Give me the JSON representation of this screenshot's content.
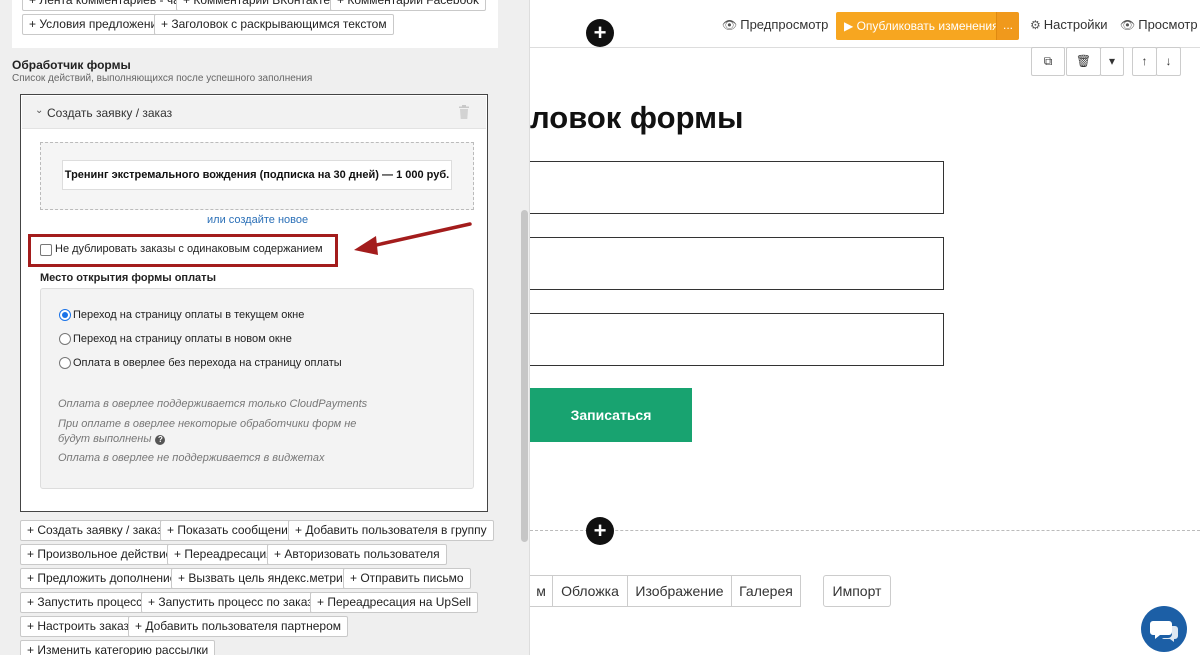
{
  "left_panel": {
    "top_buttons": [
      "+ Лента комментариев - чат",
      "+ Комментарии ВКонтакте",
      "+ Комментарии Facebook",
      "+ Условия предложений",
      "+ Заголовок с раскрывающимся текстом"
    ],
    "section_title": "Обработчик формы",
    "section_subtitle": "Список действий, выполняющихся после успешного заполнения",
    "handler": {
      "title": "Создать заявку / заказ",
      "product": "Тренинг экстремального вождения (подписка на 30 дней) — 1 000 руб.",
      "create_new_link": "или создайте новое",
      "dedupe_label": "Не дублировать заказы с одинаковым содержанием",
      "dedupe_checked": false,
      "payment_title": "Место открытия формы оплаты",
      "payment_options": [
        "Переход на страницу оплаты в текущем окне",
        "Переход на страницу оплаты в новом окне",
        "Оплата в оверлее без перехода на страницу оплаты"
      ],
      "payment_selected": 0,
      "notes": [
        "Оплата в оверлее поддерживается только CloudPayments",
        "При оплате в оверлее некоторые обработчики форм не будут выполнены",
        "Оплата в оверлее не поддерживается в виджетах"
      ],
      "help_glyph": "?"
    },
    "action_buttons": [
      "+ Создать заявку / заказ",
      "+ Показать сообщение",
      "+ Добавить пользователя в группу",
      "+ Произвольное действие",
      "+ Переадресация",
      "+ Авторизовать пользователя",
      "+ Предложить дополнение",
      "+ Вызвать цель яндекс.метрики",
      "+ Отправить письмо",
      "+ Запустить процесс",
      "+ Запустить процесс по заказу",
      "+ Переадресация на UpSell",
      "+ Настроить заказ",
      "+ Добавить пользователя партнером",
      "+ Изменить категорию рассылки"
    ]
  },
  "top_bar": {
    "preview": "Предпросмотр",
    "publish": "▶ Опубликовать изменения",
    "publish_more": "...",
    "settings": "Настройки",
    "view": "Просмотр",
    "plus": "+"
  },
  "toolbar": {
    "copy": "⧉",
    "delete": "🗑",
    "dropdown": "▾",
    "up": "↑",
    "down": "↓"
  },
  "form": {
    "title": "ловок формы",
    "submit": "Записаться"
  },
  "block_tabs": [
    "м",
    "Обложка",
    "Изображение",
    "Галерея",
    "Импорт"
  ],
  "colors": {
    "publish": "#f7a620",
    "submit": "#18a370",
    "highlight": "#a31c1c",
    "link": "#2a6fb7",
    "chat": "#1c5fa6"
  }
}
